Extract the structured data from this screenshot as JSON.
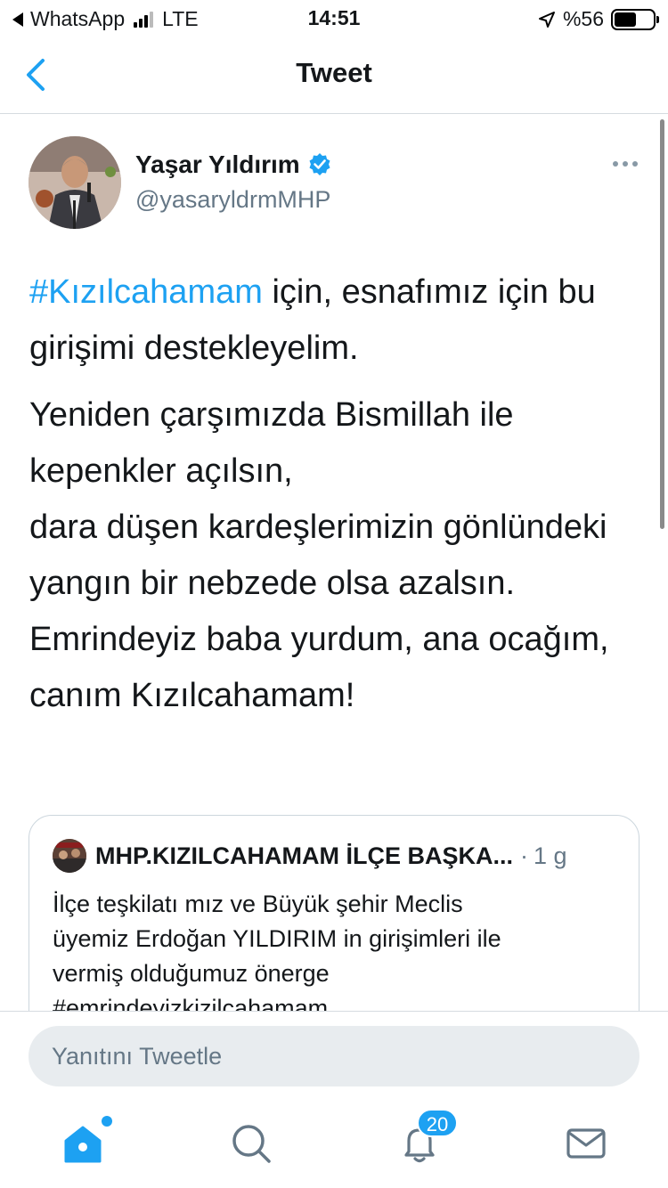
{
  "status_bar": {
    "back_app": "WhatsApp",
    "network": "LTE",
    "time": "14:51",
    "battery": "%56",
    "battery_level": 0.56
  },
  "nav": {
    "title": "Tweet"
  },
  "tweet": {
    "author_name": "Yaşar Yıldırım",
    "handle": "@yasaryldrmMHP",
    "hashtag": "#Kızılcahamam",
    "line1_rest": " için, esnafımız için bu girişimi destekleyelim.",
    "paragraph2": "Yeniden çarşımızda Bismillah ile kepenkler açılsın,",
    "paragraph3": "dara düşen kardeşlerimizin gönlündeki yangın bir nebzede olsa azalsın.",
    "paragraph4": "Emrindeyiz baba yurdum, ana ocağım,  canım Kızılcahamam!"
  },
  "quote": {
    "name": "MHP.KIZILCAHAMAM İLÇE BAŞKA...",
    "dot": "·",
    "time": "1 g",
    "text_line1": "İlçe teşkilatı mız ve  Büyük şehir Meclis",
    "text_line2": "üyemiz Erdoğan YILDIRIM in  girişimleri ile",
    "text_line3": "vermiş olduğumuz önerge",
    "text_line4": "#emrindeyizkizilcahamam"
  },
  "reply": {
    "placeholder": "Yanıtını Tweetle"
  },
  "tabs": {
    "notifications_badge": "20"
  },
  "colors": {
    "accent": "#1da1f2",
    "secondary_text": "#657786",
    "border": "#ccd6dd"
  }
}
